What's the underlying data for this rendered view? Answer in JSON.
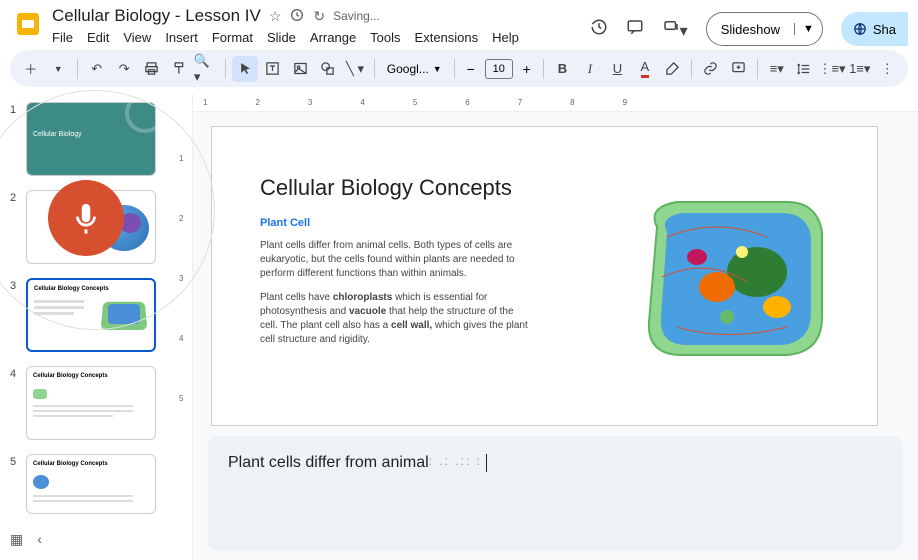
{
  "doc": {
    "title": "Cellular Biology - Lesson IV",
    "saving": "Saving..."
  },
  "menu": {
    "file": "File",
    "edit": "Edit",
    "view": "View",
    "insert": "Insert",
    "format": "Format",
    "slide": "Slide",
    "arrange": "Arrange",
    "tools": "Tools",
    "extensions": "Extensions",
    "help": "Help"
  },
  "header": {
    "slideshow": "Slideshow",
    "share": "Sha"
  },
  "toolbar": {
    "font": "Googl...",
    "size": "10"
  },
  "ruler": {
    "h": [
      "1",
      "2",
      "3",
      "4",
      "5",
      "6",
      "7",
      "8",
      "9"
    ],
    "v": [
      "1",
      "2",
      "3",
      "4",
      "5"
    ]
  },
  "thumbs": {
    "n1": "1",
    "n2": "2",
    "n3": "3",
    "n4": "4",
    "n5": "5",
    "t1": "Cellular Biology",
    "t3": "Cellular Biology Concepts",
    "t4": "Cellular Biology Concepts",
    "t5": "Cellular Biology Concepts"
  },
  "slide": {
    "title": "Cellular Biology Concepts",
    "subhead": "Plant Cell",
    "p1": "Plant cells differ from animal cells. Both types of cells are eukaryotic, but the cells found within plants are needed to perform different functions than within animals.",
    "p2a": "Plant cells have ",
    "p2b": "chloroplasts",
    "p2c": " which is essential for photosynthesis and ",
    "p2d": "vacuole",
    "p2e": " that help the structure of the cell. The plant cell also has a ",
    "p2f": "cell wall,",
    "p2g": " which gives the plant cell structure and rigidity."
  },
  "speaker": {
    "text": "Plant cells differ from animal",
    "dots": ": .: .:: :"
  }
}
